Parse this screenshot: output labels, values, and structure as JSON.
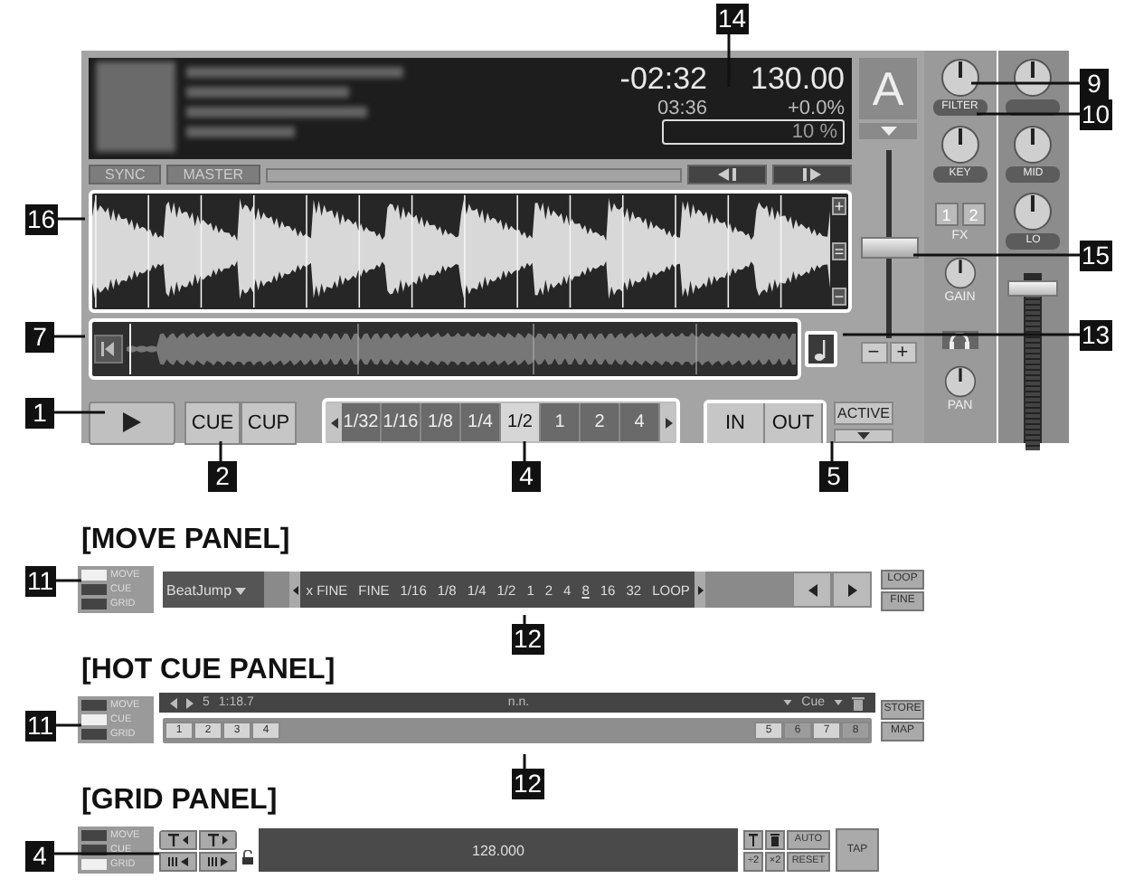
{
  "deck": {
    "time_remaining": "-02:32",
    "bpm": "130.00",
    "time_total": "03:36",
    "tempo": "+0.0%",
    "tempo_range": "10 %",
    "sync": "SYNC",
    "master": "MASTER",
    "letter": "A",
    "zoom_buttons": [
      "+",
      "=",
      "−"
    ],
    "tempo_fader": {
      "level": 0.52
    },
    "tempo_buttons": [
      "−",
      "+"
    ],
    "cue_buttons": [
      "CUE",
      "CUP"
    ],
    "loop_sizes": [
      {
        "label": "1/32",
        "selected": false
      },
      {
        "label": "1/16",
        "selected": false
      },
      {
        "label": "1/8",
        "selected": false
      },
      {
        "label": "1/4",
        "selected": false
      },
      {
        "label": "1/2",
        "selected": true
      },
      {
        "label": "1",
        "selected": false
      },
      {
        "label": "2",
        "selected": false
      },
      {
        "label": "4",
        "selected": false
      }
    ],
    "loop_buttons": [
      "IN",
      "OUT"
    ],
    "active": "ACTIVE"
  },
  "mixer": {
    "left_knobs": [
      {
        "label": "FILTER"
      },
      {
        "label": "KEY"
      }
    ],
    "right_knobs": [
      {
        "label": "MID"
      },
      {
        "label": "LO"
      }
    ],
    "fx": {
      "label": "FX",
      "buttons": [
        "1",
        "2"
      ]
    },
    "gain": {
      "label": "GAIN"
    },
    "pan": {
      "label": "PAN"
    },
    "channel_fader": {
      "level": 0.95
    }
  },
  "callouts": [
    {
      "number": "14"
    },
    {
      "number": "9"
    },
    {
      "number": "10"
    },
    {
      "number": "16"
    },
    {
      "number": "15"
    },
    {
      "number": "7"
    },
    {
      "number": "13"
    },
    {
      "number": "1"
    },
    {
      "number": "2"
    },
    {
      "number": "4"
    },
    {
      "number": "5"
    },
    {
      "number": "11"
    },
    {
      "number": "12"
    },
    {
      "number": "11"
    },
    {
      "number": "12"
    },
    {
      "number": "4"
    }
  ],
  "move_panel": {
    "heading": "[MOVE PANEL]",
    "modes": [
      {
        "label": "MOVE",
        "selected": true
      },
      {
        "label": "CUE",
        "selected": false
      },
      {
        "label": "GRID",
        "selected": false
      }
    ],
    "mode": "BeatJump",
    "sizes": [
      {
        "label": "x FINE",
        "selected": false
      },
      {
        "label": "FINE",
        "selected": false
      },
      {
        "label": "1/16",
        "selected": false
      },
      {
        "label": "1/8",
        "selected": false
      },
      {
        "label": "1/4",
        "selected": false
      },
      {
        "label": "1/2",
        "selected": false
      },
      {
        "label": "1",
        "selected": false
      },
      {
        "label": "2",
        "selected": false
      },
      {
        "label": "4",
        "selected": false
      },
      {
        "label": "8",
        "selected": true
      },
      {
        "label": "16",
        "selected": false
      },
      {
        "label": "32",
        "selected": false
      },
      {
        "label": "LOOP",
        "selected": false
      }
    ],
    "side_buttons": [
      "LOOP",
      "FINE"
    ]
  },
  "hot_cue_panel": {
    "heading": "[HOT CUE PANEL]",
    "modes": [
      {
        "label": "MOVE",
        "selected": false
      },
      {
        "label": "CUE",
        "selected": true
      },
      {
        "label": "GRID",
        "selected": false
      }
    ],
    "cue_number": "5",
    "cue_position": "1:18.7",
    "cue_name": "n.n.",
    "cue_type": "Cue",
    "cues": [
      {
        "label": "1",
        "set": true
      },
      {
        "label": "2",
        "set": true
      },
      {
        "label": "3",
        "set": true
      },
      {
        "label": "4",
        "set": true
      },
      {
        "label": "5",
        "set": true
      },
      {
        "label": "6",
        "set": false
      },
      {
        "label": "7",
        "set": true
      },
      {
        "label": "8",
        "set": false
      }
    ],
    "side_buttons": [
      "STORE",
      "MAP"
    ]
  },
  "grid_panel": {
    "heading": "[GRID PANEL]",
    "modes": [
      {
        "label": "MOVE",
        "selected": false
      },
      {
        "label": "CUE",
        "selected": false
      },
      {
        "label": "GRID",
        "selected": true
      }
    ],
    "tempo": "128.000",
    "auto": "AUTO",
    "half": "÷2",
    "double": "×2",
    "reset": "RESET",
    "tap": "TAP"
  }
}
